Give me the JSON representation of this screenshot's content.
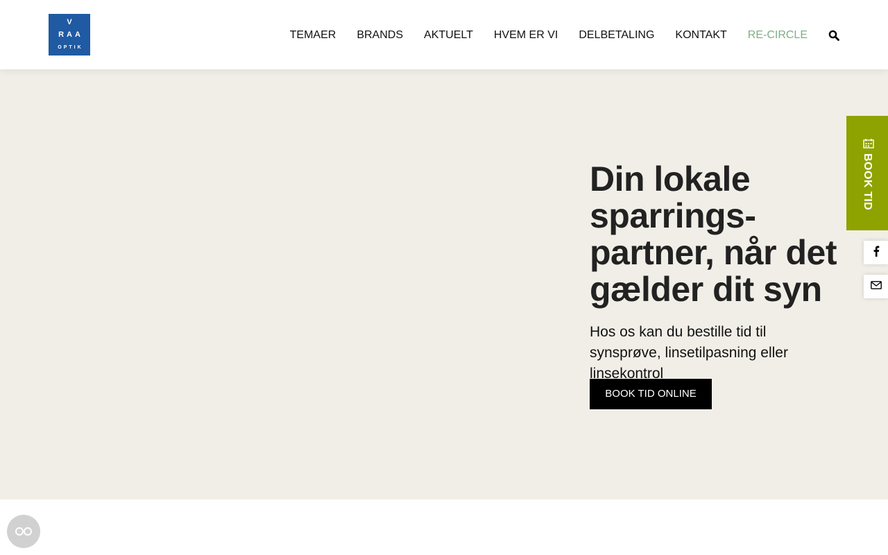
{
  "logo": {
    "line1": "V",
    "line2": "RAA",
    "line3": "OPTIK"
  },
  "nav": {
    "items": [
      {
        "label": "TEMAER"
      },
      {
        "label": "BRANDS"
      },
      {
        "label": "AKTUELT"
      },
      {
        "label": "HVEM ER VI"
      },
      {
        "label": "DELBETALING"
      },
      {
        "label": "KONTAKT"
      },
      {
        "label": "RE-CIRCLE"
      }
    ],
    "search_icon": "search-icon"
  },
  "hero": {
    "title": "Din lokale sparrings-partner, når det gælder dit syn",
    "subtitle": "Hos os kan du bestille tid til synsprøve, linsetilpasning eller linsekontrol",
    "button_label": "BOOK TID ONLINE"
  },
  "side": {
    "book_label": "BOOK TID",
    "book_icon": "calendar-icon",
    "facebook_icon": "facebook-icon",
    "mail_icon": "mail-icon"
  },
  "cookie_icon": "cookie-consent-icon",
  "colors": {
    "brand_blue": "#1f5aa3",
    "accent_green": "#7fae86",
    "book_tab": "#8ea300",
    "hero_bg": "#f1eee7",
    "button_bg": "#000000"
  }
}
